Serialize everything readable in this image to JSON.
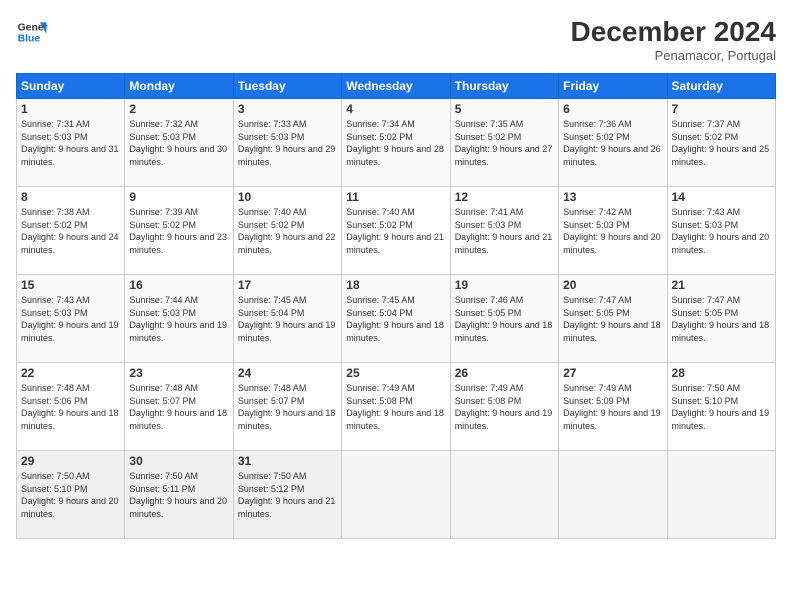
{
  "header": {
    "logo_line1": "General",
    "logo_line2": "Blue",
    "month": "December 2024",
    "location": "Penamacor, Portugal"
  },
  "weekdays": [
    "Sunday",
    "Monday",
    "Tuesday",
    "Wednesday",
    "Thursday",
    "Friday",
    "Saturday"
  ],
  "weeks": [
    [
      {
        "day": "1",
        "sunrise": "7:31 AM",
        "sunset": "5:03 PM",
        "daylight": "9 hours and 31 minutes."
      },
      {
        "day": "2",
        "sunrise": "7:32 AM",
        "sunset": "5:03 PM",
        "daylight": "9 hours and 30 minutes."
      },
      {
        "day": "3",
        "sunrise": "7:33 AM",
        "sunset": "5:03 PM",
        "daylight": "9 hours and 29 minutes."
      },
      {
        "day": "4",
        "sunrise": "7:34 AM",
        "sunset": "5:02 PM",
        "daylight": "9 hours and 28 minutes."
      },
      {
        "day": "5",
        "sunrise": "7:35 AM",
        "sunset": "5:02 PM",
        "daylight": "9 hours and 27 minutes."
      },
      {
        "day": "6",
        "sunrise": "7:36 AM",
        "sunset": "5:02 PM",
        "daylight": "9 hours and 26 minutes."
      },
      {
        "day": "7",
        "sunrise": "7:37 AM",
        "sunset": "5:02 PM",
        "daylight": "9 hours and 25 minutes."
      }
    ],
    [
      {
        "day": "8",
        "sunrise": "7:38 AM",
        "sunset": "5:02 PM",
        "daylight": "9 hours and 24 minutes."
      },
      {
        "day": "9",
        "sunrise": "7:39 AM",
        "sunset": "5:02 PM",
        "daylight": "9 hours and 23 minutes."
      },
      {
        "day": "10",
        "sunrise": "7:40 AM",
        "sunset": "5:02 PM",
        "daylight": "9 hours and 22 minutes."
      },
      {
        "day": "11",
        "sunrise": "7:40 AM",
        "sunset": "5:02 PM",
        "daylight": "9 hours and 21 minutes."
      },
      {
        "day": "12",
        "sunrise": "7:41 AM",
        "sunset": "5:03 PM",
        "daylight": "9 hours and 21 minutes."
      },
      {
        "day": "13",
        "sunrise": "7:42 AM",
        "sunset": "5:03 PM",
        "daylight": "9 hours and 20 minutes."
      },
      {
        "day": "14",
        "sunrise": "7:43 AM",
        "sunset": "5:03 PM",
        "daylight": "9 hours and 20 minutes."
      }
    ],
    [
      {
        "day": "15",
        "sunrise": "7:43 AM",
        "sunset": "5:03 PM",
        "daylight": "9 hours and 19 minutes."
      },
      {
        "day": "16",
        "sunrise": "7:44 AM",
        "sunset": "5:03 PM",
        "daylight": "9 hours and 19 minutes."
      },
      {
        "day": "17",
        "sunrise": "7:45 AM",
        "sunset": "5:04 PM",
        "daylight": "9 hours and 19 minutes."
      },
      {
        "day": "18",
        "sunrise": "7:45 AM",
        "sunset": "5:04 PM",
        "daylight": "9 hours and 18 minutes."
      },
      {
        "day": "19",
        "sunrise": "7:46 AM",
        "sunset": "5:05 PM",
        "daylight": "9 hours and 18 minutes."
      },
      {
        "day": "20",
        "sunrise": "7:47 AM",
        "sunset": "5:05 PM",
        "daylight": "9 hours and 18 minutes."
      },
      {
        "day": "21",
        "sunrise": "7:47 AM",
        "sunset": "5:05 PM",
        "daylight": "9 hours and 18 minutes."
      }
    ],
    [
      {
        "day": "22",
        "sunrise": "7:48 AM",
        "sunset": "5:06 PM",
        "daylight": "9 hours and 18 minutes."
      },
      {
        "day": "23",
        "sunrise": "7:48 AM",
        "sunset": "5:07 PM",
        "daylight": "9 hours and 18 minutes."
      },
      {
        "day": "24",
        "sunrise": "7:48 AM",
        "sunset": "5:07 PM",
        "daylight": "9 hours and 18 minutes."
      },
      {
        "day": "25",
        "sunrise": "7:49 AM",
        "sunset": "5:08 PM",
        "daylight": "9 hours and 18 minutes."
      },
      {
        "day": "26",
        "sunrise": "7:49 AM",
        "sunset": "5:08 PM",
        "daylight": "9 hours and 19 minutes."
      },
      {
        "day": "27",
        "sunrise": "7:49 AM",
        "sunset": "5:09 PM",
        "daylight": "9 hours and 19 minutes."
      },
      {
        "day": "28",
        "sunrise": "7:50 AM",
        "sunset": "5:10 PM",
        "daylight": "9 hours and 19 minutes."
      }
    ],
    [
      {
        "day": "29",
        "sunrise": "7:50 AM",
        "sunset": "5:10 PM",
        "daylight": "9 hours and 20 minutes."
      },
      {
        "day": "30",
        "sunrise": "7:50 AM",
        "sunset": "5:11 PM",
        "daylight": "9 hours and 20 minutes."
      },
      {
        "day": "31",
        "sunrise": "7:50 AM",
        "sunset": "5:12 PM",
        "daylight": "9 hours and 21 minutes."
      },
      null,
      null,
      null,
      null
    ]
  ]
}
